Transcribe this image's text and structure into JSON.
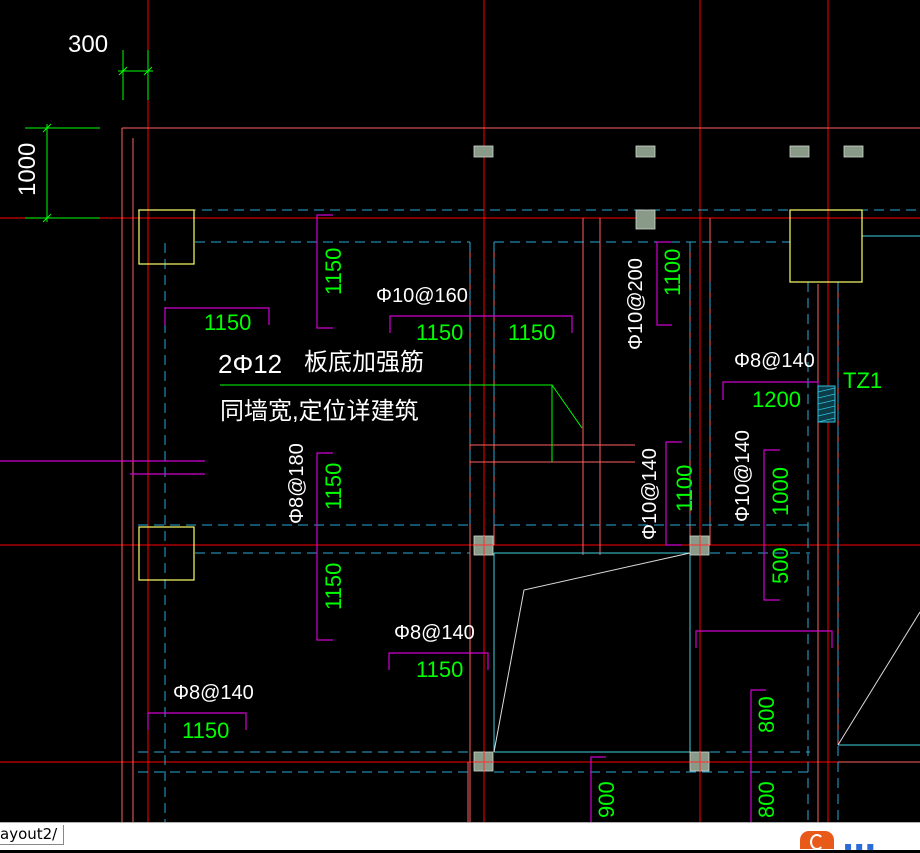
{
  "dimensions": {
    "top_width": "300",
    "left_height": "1000",
    "d_1150_a": "1150",
    "d_1150_b": "1150",
    "d_1150_c": "1150",
    "d_1150_v1": "1150",
    "d_1150_v2": "1150",
    "d_1150_v3": "1150",
    "d_1150_d": "1150",
    "d_1150_e": "1150",
    "d_1100_a": "1100",
    "d_1100_b": "1100",
    "d_1200": "1200",
    "d_1000": "1000",
    "d_500": "500",
    "d_800_a": "800",
    "d_800_b": "800",
    "d_900": "900"
  },
  "rebar": {
    "r1": "Φ10@160",
    "r2": "Φ10@200",
    "r3": "Φ8@140",
    "r4": "Φ8@180",
    "r5": "Φ10@140",
    "r6": "Φ10@140",
    "r7": "Φ8@140",
    "r8": "Φ8@140"
  },
  "notes": {
    "bar_spec": "2Φ12",
    "bar_title": "板底加强筋",
    "bar_desc": "同墙宽,定位详建筑",
    "column_tag": "TZ1"
  },
  "tabs": {
    "layout2": "ayout2/"
  },
  "colors": {
    "background": "#000000",
    "axis": "#ff0000",
    "wall": "#ff5a5a",
    "beam": "#2aa7d4",
    "dim_text": "#00ff00",
    "rebar_bracket": "#d000d0",
    "column": "#ffff66",
    "text": "#ffffff"
  }
}
